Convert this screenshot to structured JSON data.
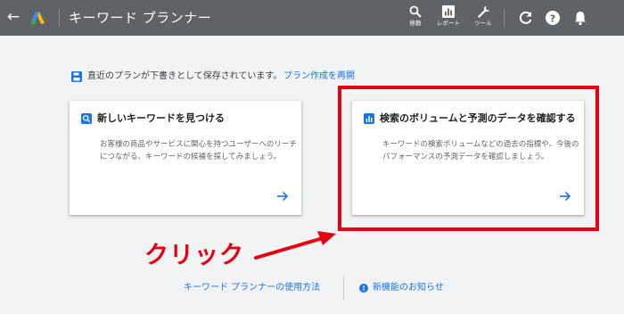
{
  "header": {
    "title": "キーワード プランナー",
    "tools": [
      {
        "label": "移動",
        "icon": "search-icon"
      },
      {
        "label": "レポート",
        "icon": "reports-icon"
      },
      {
        "label": "ツール",
        "icon": "wrench-icon"
      }
    ],
    "right_icons": [
      "refresh-icon",
      "help-icon",
      "notifications-icon"
    ]
  },
  "notice": {
    "text": "直近のプランが下書きとして保存されています。",
    "link": "プラン作成を再開"
  },
  "cards": [
    {
      "title": "新しいキーワードを見つける",
      "description": "お客様の商品やサービスに関心を持つユーザーへのリーチにつながる、キーワードの候補を探してみましょう。",
      "icon": "search-icon"
    },
    {
      "title": "検索のボリュームと予測のデータを確認する",
      "description": "キーワードの検索ボリュームなどの過去の指標や、今後のパフォーマンスの予測データを確認しましょう。",
      "icon": "bar-chart-icon"
    }
  ],
  "annotation": {
    "label": "クリック",
    "color": "#e60012"
  },
  "footer": {
    "usage_link": "キーワード プランナーの使用方法",
    "news_link": "新機能のお知らせ"
  },
  "colors": {
    "topbar": "#5f6368",
    "accent": "#1a73e8",
    "highlight": "#e60012"
  }
}
